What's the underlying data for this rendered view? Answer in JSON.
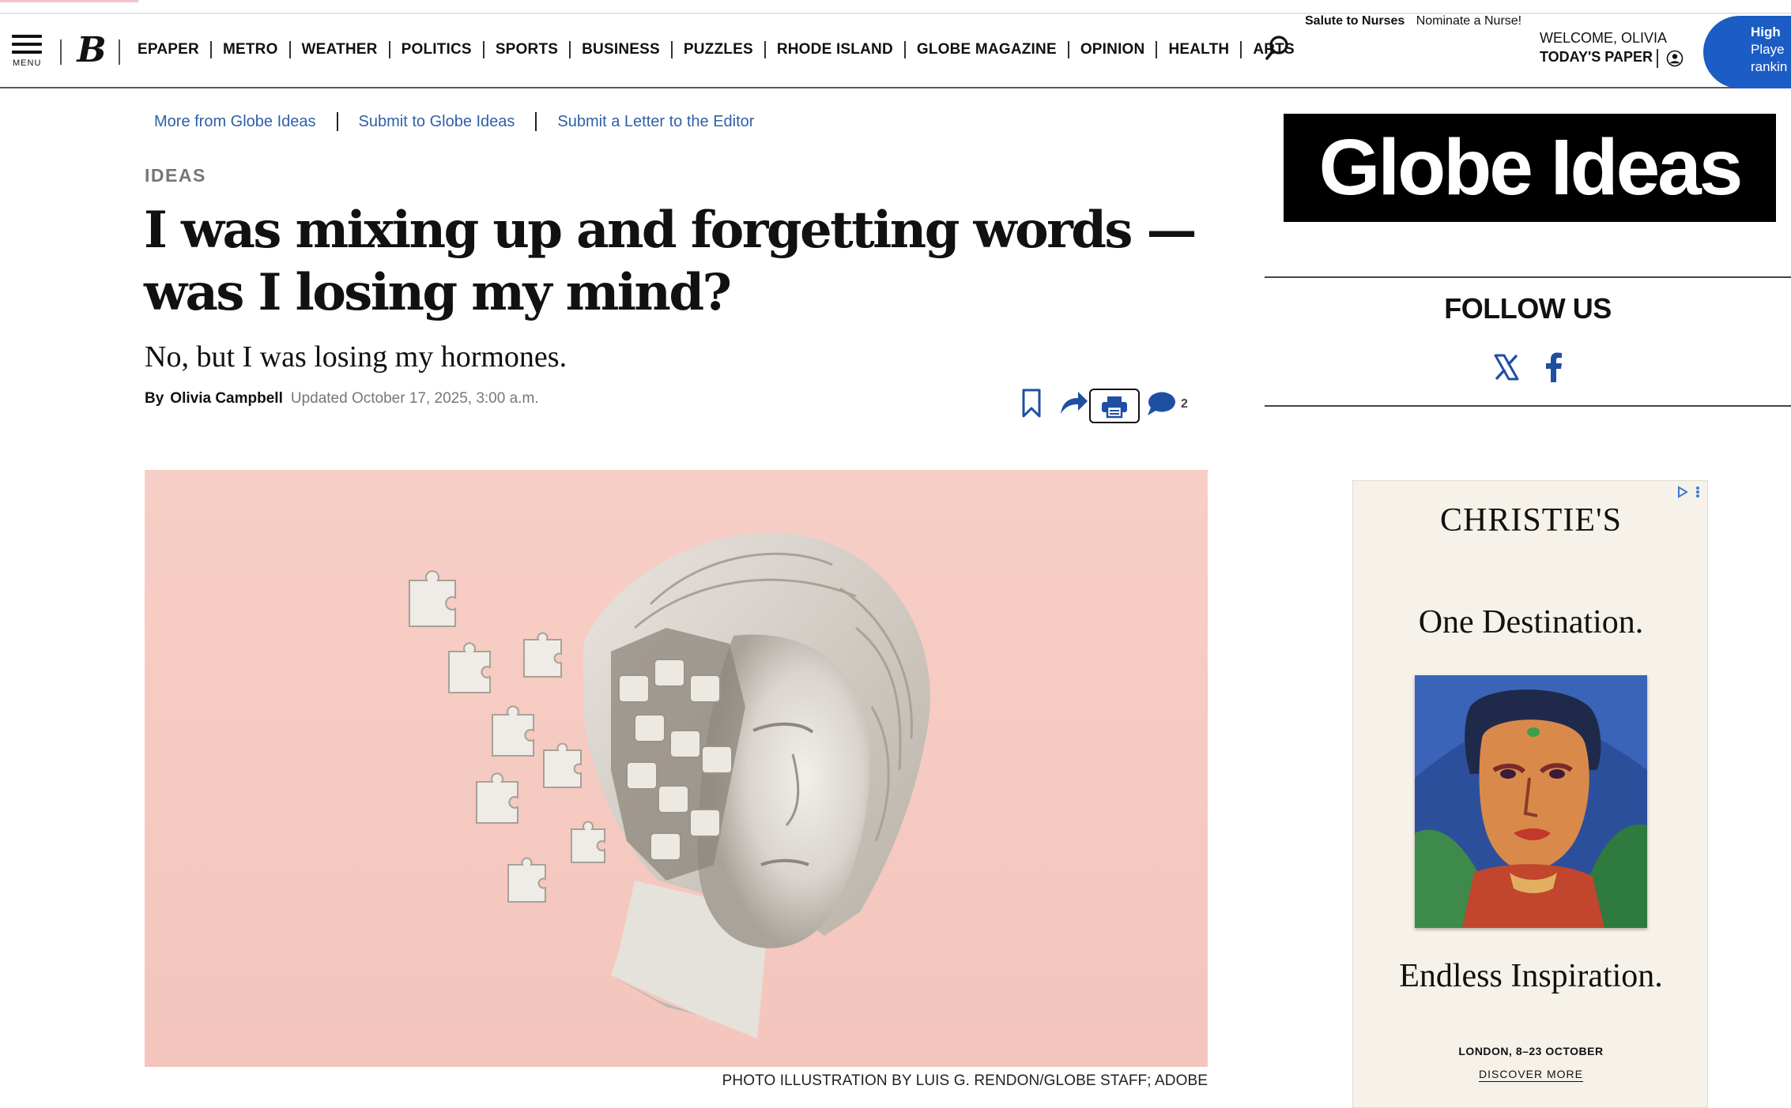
{
  "header": {
    "menu_label": "MENU",
    "logo_text": "B",
    "nav": [
      "EPAPER",
      "METRO",
      "WEATHER",
      "POLITICS",
      "SPORTS",
      "BUSINESS",
      "PUZZLES",
      "RHODE ISLAND",
      "GLOBE MAGAZINE",
      "OPINION",
      "HEALTH",
      "ARTS"
    ],
    "promo_primary": "Salute to Nurses",
    "promo_secondary": "Nominate a Nurse!",
    "welcome": "WELCOME, OLIVIA",
    "todays_paper": "TODAY'S PAPER",
    "promo_pill": {
      "line1": "High",
      "line2": "Playe",
      "line3": "rankin"
    }
  },
  "article": {
    "sublinks": [
      "More from Globe Ideas",
      "Submit to Globe Ideas",
      "Submit a Letter to the Editor"
    ],
    "kicker": "IDEAS",
    "headline": "I was mixing up and forgetting words — was I losing my mind?",
    "subhead": "No, but I was losing my hormones.",
    "byline_prefix": "By",
    "author": "Olivia Campbell",
    "updated": "Updated October 17, 2025, 3:00 a.m.",
    "comment_count": "2",
    "photo_caption": "PHOTO ILLUSTRATION BY LUIS G. RENDON/GLOBE STAFF; ADOBE"
  },
  "sidebar": {
    "section_title": "Globe Ideas",
    "follow_us": "FOLLOW US",
    "ad": {
      "brand": "CHRISTIE'S",
      "line1": "One Destination.",
      "line2": "Endless Inspiration.",
      "dates": "LONDON, 8–23 OCTOBER",
      "cta": "DISCOVER MORE"
    }
  },
  "colors": {
    "link_blue": "#2f5fa8",
    "accent_blue": "#1b5dc4",
    "hero_bg": "#f5cac1",
    "ad_bg": "#f6f2ea"
  }
}
